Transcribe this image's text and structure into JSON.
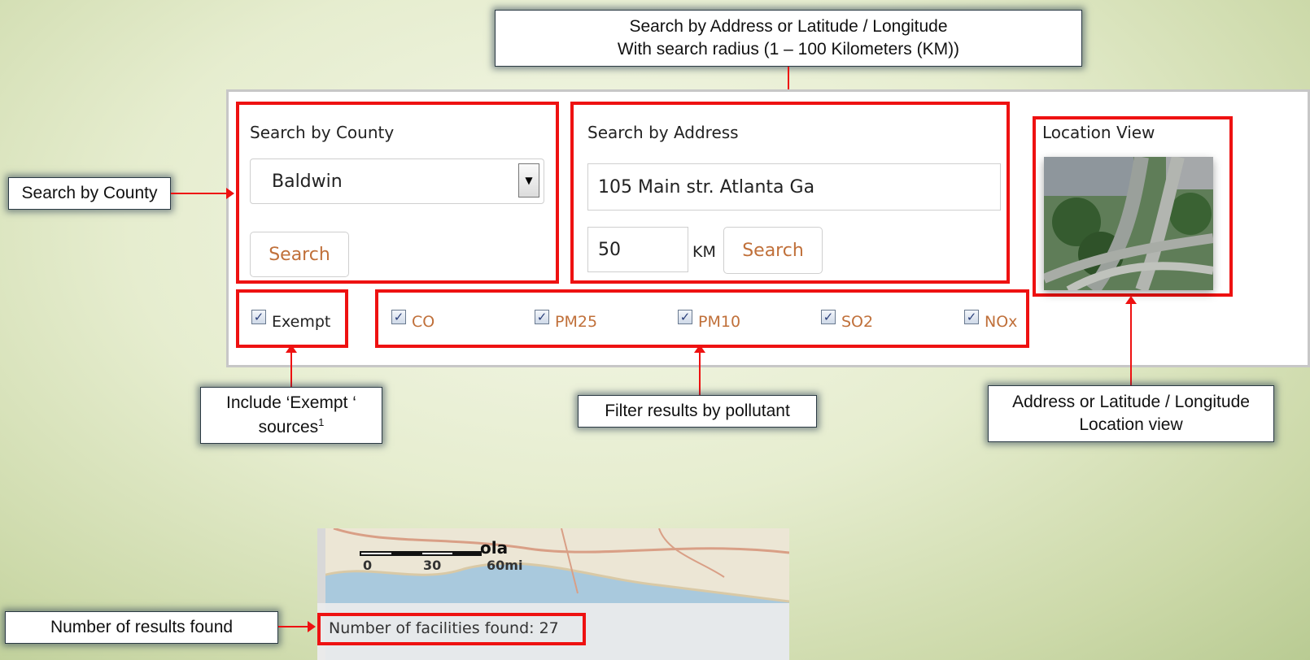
{
  "callouts": {
    "top_line1": "Search by Address or Latitude / Longitude",
    "top_line2": "With search radius (1 – 100 Kilometers (KM))",
    "county": "Search by County",
    "exempt_line1": "Include ‘Exempt ‘",
    "exempt_line2": "sources",
    "exempt_sup": "1",
    "pollutant": "Filter results by pollutant",
    "location_line1": "Address or Latitude / Longitude",
    "location_line2": "Location view",
    "results": "Number of results found"
  },
  "county_search": {
    "heading": "Search by County",
    "selected": "Baldwin",
    "button": "Search"
  },
  "address_search": {
    "heading": "Search by Address",
    "address_value": "105 Main str. Atlanta Ga",
    "radius_value": "50",
    "radius_unit": "KM",
    "button": "Search"
  },
  "location_view": {
    "heading": "Location View"
  },
  "filters": {
    "exempt": {
      "label": "Exempt",
      "checked": true
    },
    "pollutants": [
      {
        "label": "CO",
        "checked": true
      },
      {
        "label": "PM25",
        "checked": true
      },
      {
        "label": "PM10",
        "checked": true
      },
      {
        "label": "SO2",
        "checked": true
      },
      {
        "label": "NOx",
        "checked": true
      }
    ]
  },
  "map": {
    "scale_labels": [
      "0",
      "30",
      "60mi"
    ],
    "place_label": "ola",
    "results_text": "Number of facilities found: 27"
  },
  "colors": {
    "highlight": "#ee1111",
    "link_orange": "#c0703a"
  }
}
